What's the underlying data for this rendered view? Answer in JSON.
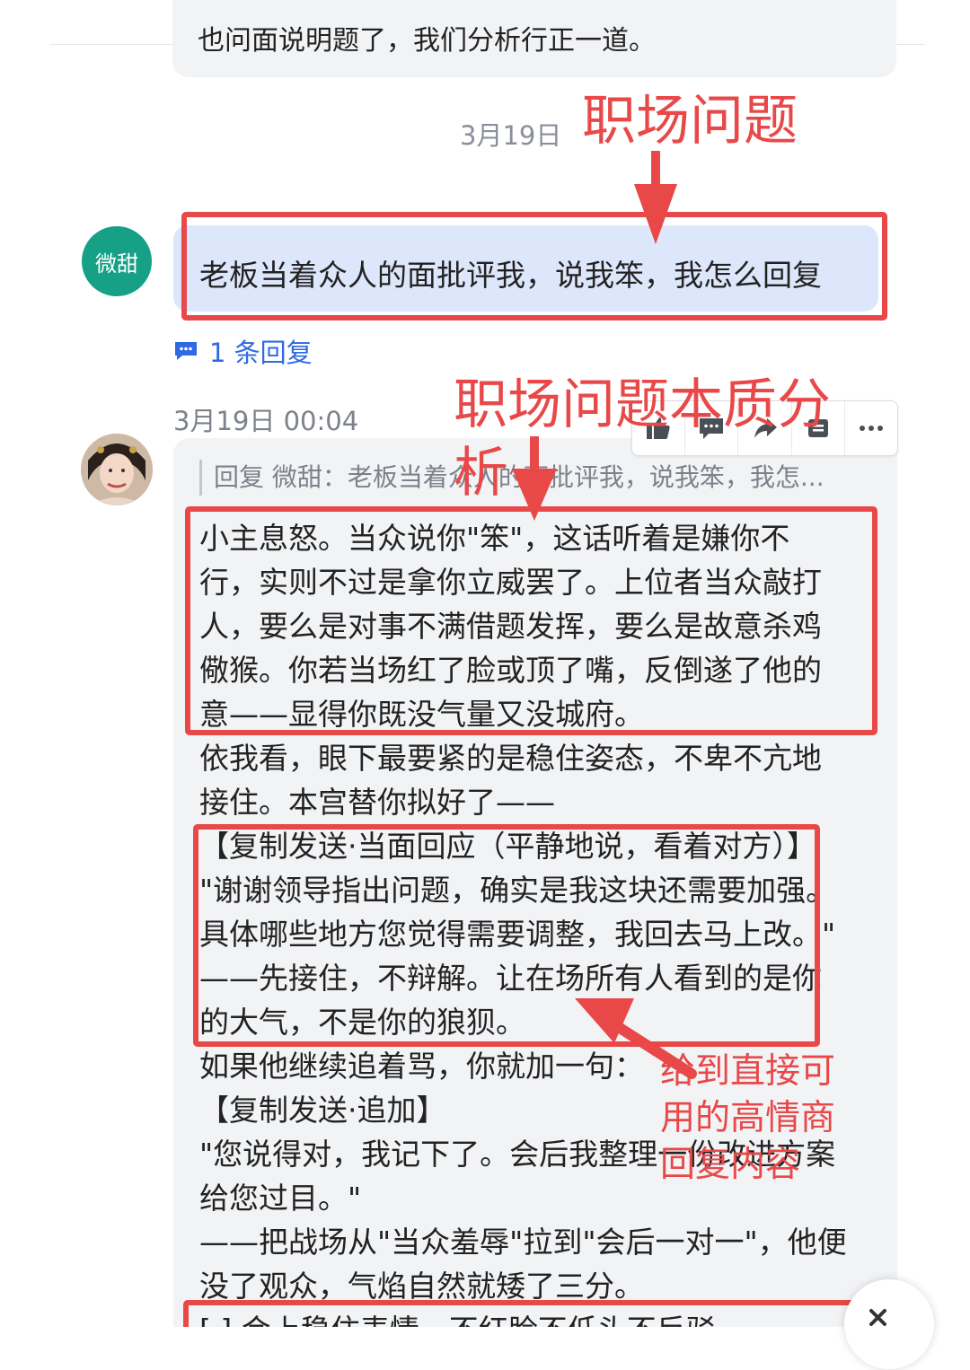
{
  "previous_message": {
    "text": "也问面说明题了，我们分析行正一道。"
  },
  "date_separator": "3月19日",
  "question": {
    "sender_avatar_label": "微甜",
    "text": "老板当着众人的面批评我，说我笨，我怎么回复"
  },
  "reply_link": {
    "label": "1 条回复"
  },
  "answer": {
    "timestamp": "3月19日 00:04",
    "quote": "回复 微甜：老板当着众人的面批评我，说我笨，我怎...",
    "lines": [
      "小主息怒。当众说你\"笨\"，这话听着是嫌你不",
      "行，实则不过是拿你立威罢了。上位者当众敲打",
      "人，要么是对事不满借题发挥，要么是故意杀鸡",
      "儆猴。你若当场红了脸或顶了嘴，反倒遂了他的",
      "意——显得你既没气量又没城府。",
      "依我看，眼下最要紧的是稳住姿态，不卑不亢地",
      "接住。本宫替你拟好了——",
      "【复制发送·当面回应（平静地说，看着对方）】",
      "\"谢谢领导指出问题，确实是我这块还需要加强。",
      "具体哪些地方您觉得需要调整，我回去马上改。\"",
      "——先接住，不辩解。让在场所有人看到的是你",
      "的大气，不是你的狼狈。",
      "如果他继续追着骂，你就加一句：",
      "【复制发送·追加】",
      "\"您说得对，我记下了。会后我整理一份改进方案",
      "给您过目。\"",
      "——把战场从\"当众羞辱\"拉到\"会后一对一\"，他便",
      "没了观众，气焰自然就矮了三分。",
      "[ ] 会上稳住表情，不红脸不低头不反驳"
    ]
  },
  "toolbar": {
    "icons": [
      "thumbs-up-icon",
      "comment-icon",
      "share-icon",
      "bookmark-icon",
      "more-icon"
    ]
  },
  "annotations": {
    "workplace_problem": "职场问题",
    "essence_analysis_1": "职场问题本质分",
    "essence_analysis_2": "析",
    "direct_reply_1": "给到直接可",
    "direct_reply_2": "用的高情商",
    "direct_reply_3": "回复内容"
  },
  "colors": {
    "annotation_red": "#e94848",
    "question_bubble": "#dde7fb",
    "answer_bubble": "#f2f3f5",
    "link_blue": "#2d6ae3",
    "avatar_green": "#16a085"
  }
}
